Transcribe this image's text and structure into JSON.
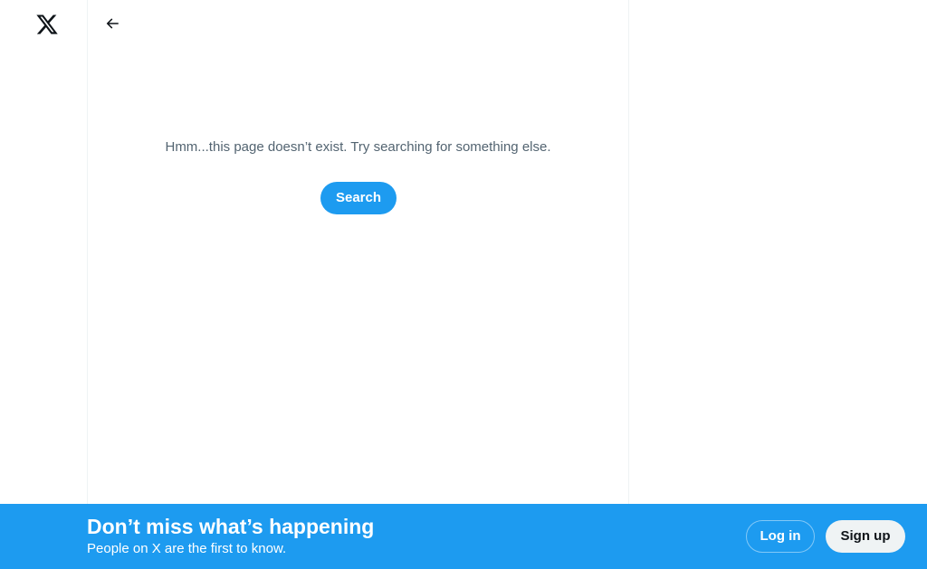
{
  "nav": {
    "logo_icon": "x-logo-icon"
  },
  "header": {
    "back_icon": "arrow-left-icon"
  },
  "main": {
    "message": "Hmm...this page doesn’t exist. Try searching for something else.",
    "search_label": "Search"
  },
  "banner": {
    "title": "Don’t miss what’s happening",
    "subtitle": "People on X are the first to know.",
    "login_label": "Log in",
    "signup_label": "Sign up"
  },
  "colors": {
    "accent": "#1d9bf0",
    "text_secondary": "#536471",
    "border": "#eff3f4",
    "signup_bg": "#eff3f4",
    "signup_text": "#0f1419"
  }
}
